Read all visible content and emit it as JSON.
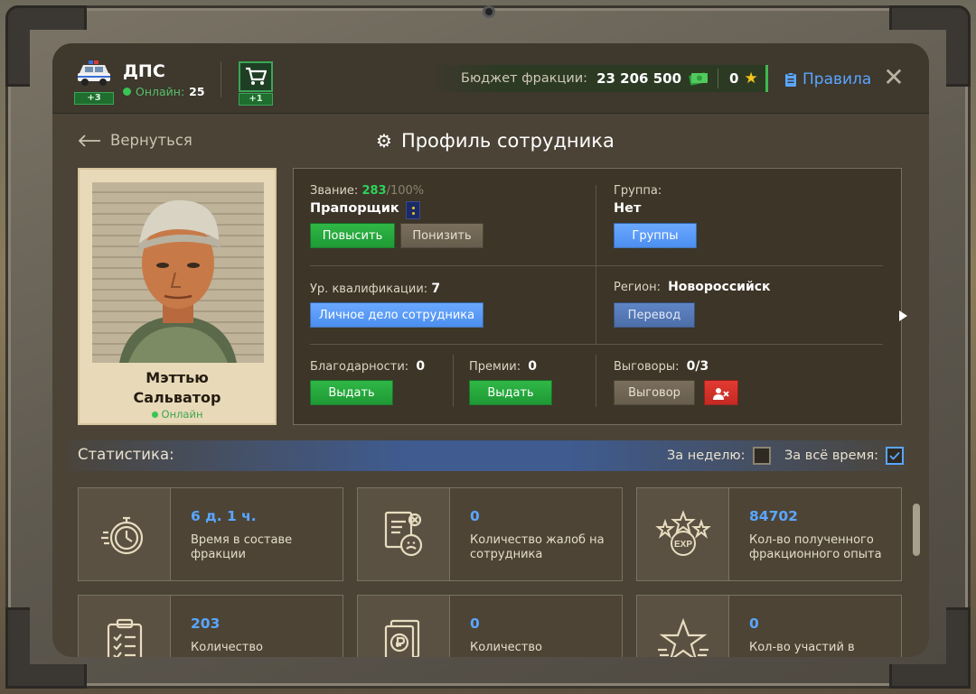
{
  "header": {
    "faction_name": "ДПС",
    "online_label": "Онлайн:",
    "online_count": "25",
    "faction_badge": "+3",
    "cart_badge": "+1",
    "budget_label": "Бюджет фракции:",
    "budget_value": "23 206 500",
    "stars_value": "0",
    "rules_label": "Правила",
    "close_icon": "✕"
  },
  "nav": {
    "back_label": "Вернуться",
    "page_title": "Профиль сотрудника"
  },
  "employee": {
    "first_name": "Мэттью",
    "last_name": "Сальватор",
    "status": "Онлайн"
  },
  "rank": {
    "label": "Звание:",
    "value": "283",
    "max": "/100%",
    "name": "Прапорщик",
    "promote_button": "Повысить",
    "demote_button": "Понизить"
  },
  "group": {
    "label": "Группа:",
    "value": "Нет",
    "button": "Группы"
  },
  "qualification": {
    "label": "Ур. квалификации:",
    "value": "7",
    "button": "Личное дело сотрудника"
  },
  "region": {
    "label": "Регион:",
    "value": "Новороссийск",
    "button": "Перевод"
  },
  "thanks": {
    "label": "Благодарности:",
    "value": "0",
    "button": "Выдать"
  },
  "bonuses": {
    "label": "Премии:",
    "value": "0",
    "button": "Выдать"
  },
  "reprimands": {
    "label": "Выговоры:",
    "value": "0",
    "max": "/3",
    "button": "Выговор"
  },
  "stats": {
    "title": "Статистика:",
    "week_label": "За неделю:",
    "week_checked": false,
    "all_time_label": "За всё время:",
    "all_time_checked": true,
    "cards": [
      {
        "value": "6 д. 1 ч.",
        "desc": "Время в составе фракции",
        "icon": "stopwatch-icon"
      },
      {
        "value": "0",
        "desc": "Количество жалоб на сотрудника",
        "icon": "complaint-document-icon"
      },
      {
        "value": "84702",
        "desc": "Кол-во полученного фракционного опыта",
        "icon": "exp-stars-icon"
      },
      {
        "value": "203",
        "desc": "Количество",
        "icon": "clipboard-checklist-icon"
      },
      {
        "value": "0",
        "desc": "Количество",
        "icon": "ruble-document-icon"
      },
      {
        "value": "0",
        "desc": "Кол-во участий в",
        "icon": "star-icon"
      }
    ]
  },
  "colors": {
    "accent_blue": "#5aa6ff",
    "accent_green": "#2fb745",
    "panel_bg": "#3c3528",
    "danger_red": "#e13a32"
  }
}
